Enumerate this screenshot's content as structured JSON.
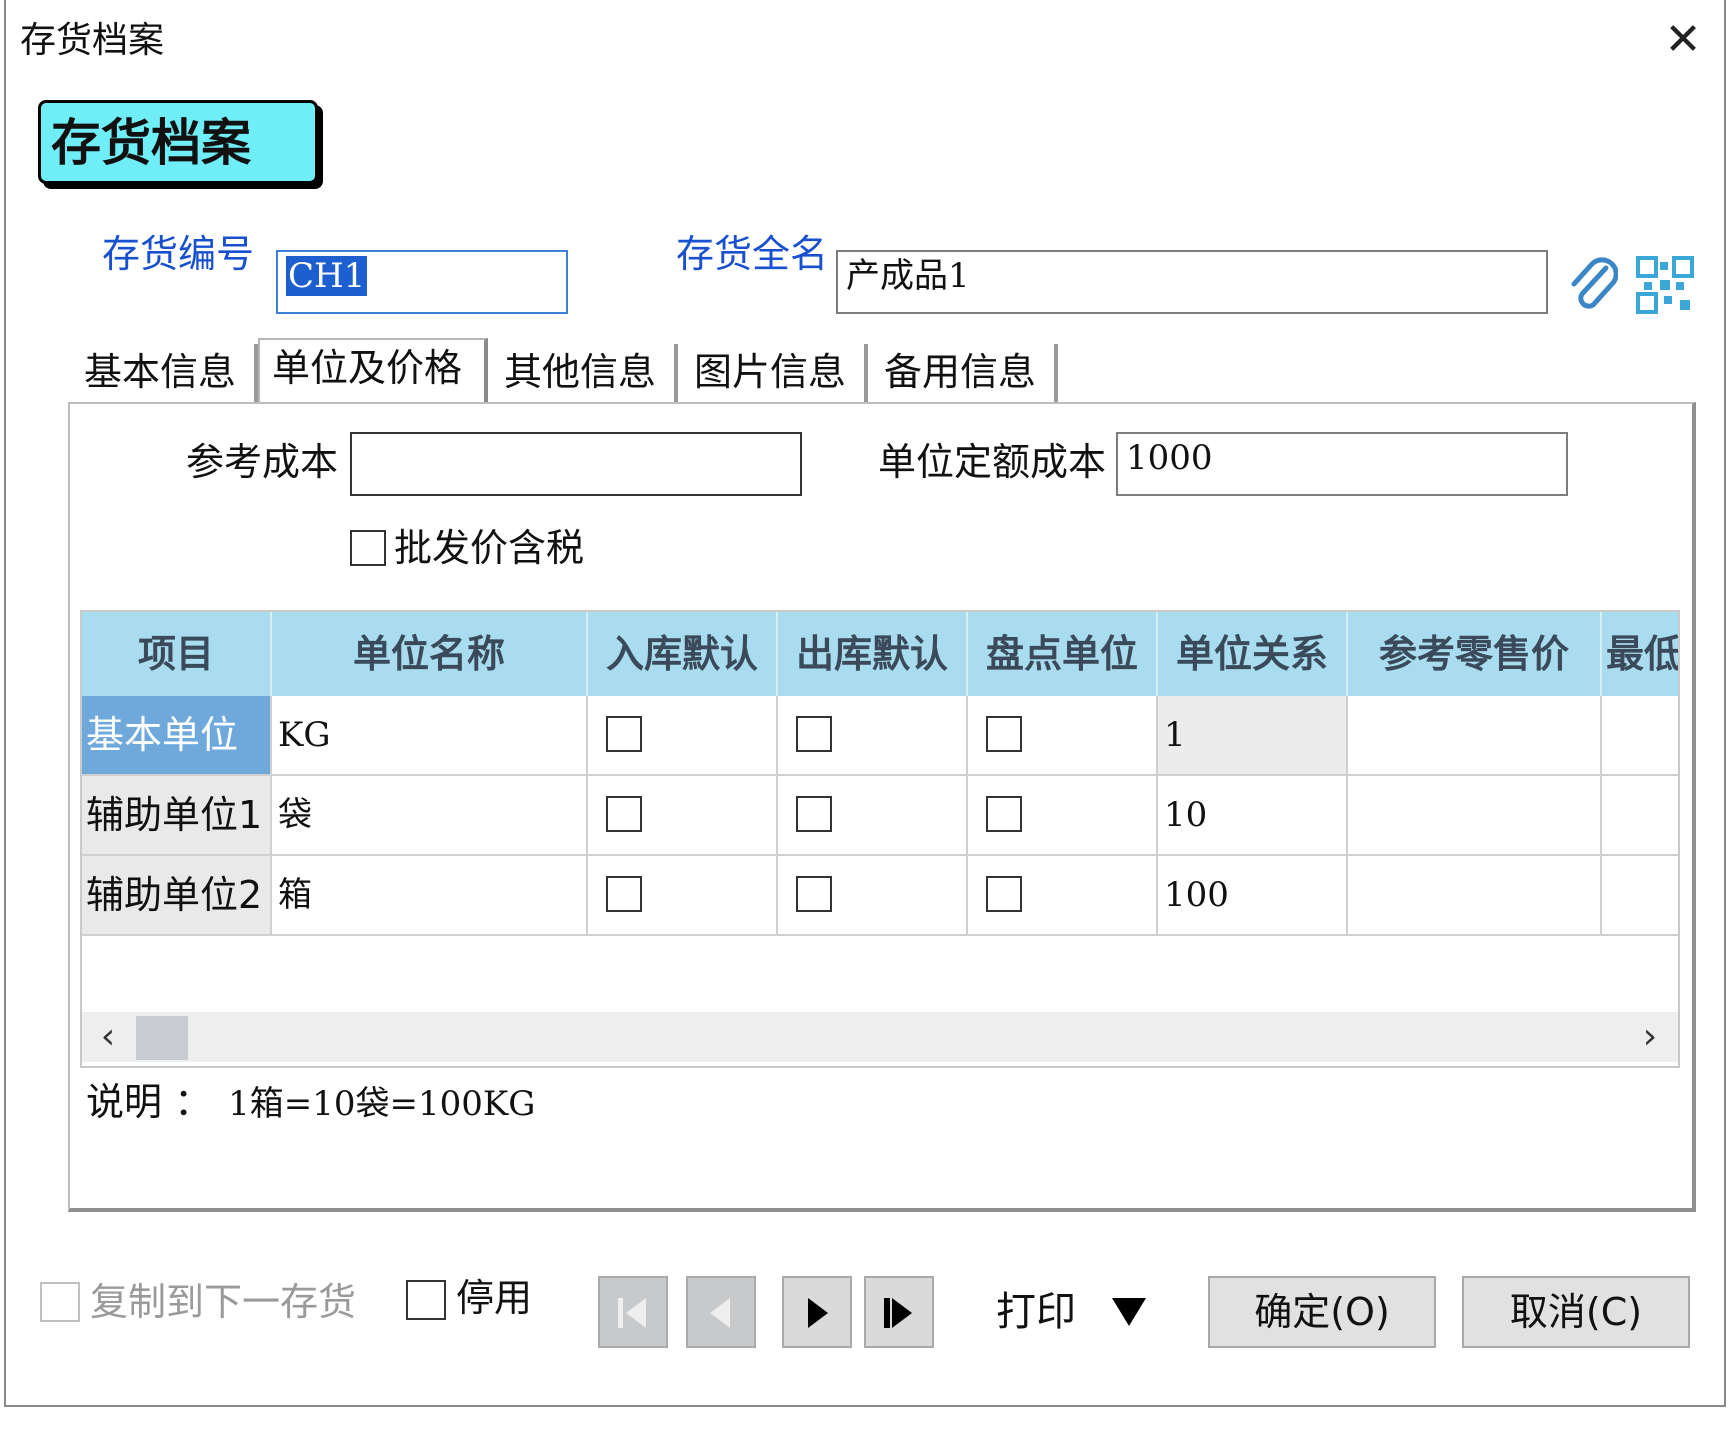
{
  "window": {
    "title": "存货档案",
    "close_glyph": "✕"
  },
  "banner": {
    "title": "存货档案"
  },
  "header": {
    "code_label": "存货编号",
    "code_value": "CH1",
    "name_label": "存货全名",
    "name_value": "产成品1",
    "attach_icon": "paperclip-icon",
    "qr_icon": "qr-code-icon"
  },
  "tabs": [
    "基本信息",
    "单位及价格",
    "其他信息",
    "图片信息",
    "备用信息"
  ],
  "active_tab": "单位及价格",
  "form": {
    "ref_cost_label": "参考成本",
    "ref_cost_value": "",
    "unit_cost_label": "单位定额成本",
    "unit_cost_value": "1000",
    "wholesale_tax_label": "批发价含税"
  },
  "grid": {
    "columns": [
      "项目",
      "单位名称",
      "入库默认",
      "出库默认",
      "盘点单位",
      "单位关系",
      "参考零售价",
      "最低"
    ],
    "rows": [
      {
        "item": "基本单位",
        "unit_name": "KG",
        "relation": "1"
      },
      {
        "item": "辅助单位1",
        "unit_name": "袋",
        "relation": "10"
      },
      {
        "item": "辅助单位2",
        "unit_name": "箱",
        "relation": "100"
      }
    ],
    "scroll_left": "‹",
    "scroll_right": "›"
  },
  "note": {
    "label": "说明 ：",
    "value": "1箱=10袋=100KG"
  },
  "footer": {
    "copy_label": "复制到下一存货",
    "disable_label": "停用",
    "print_label": "打印",
    "ok_label": "确定(O)",
    "cancel_label": "取消(C)"
  },
  "colors": {
    "banner": "#70eef8",
    "header_row": "#a8dcee",
    "selected_rowhead": "#6fa9dc",
    "blue_label": "#1850d0"
  }
}
